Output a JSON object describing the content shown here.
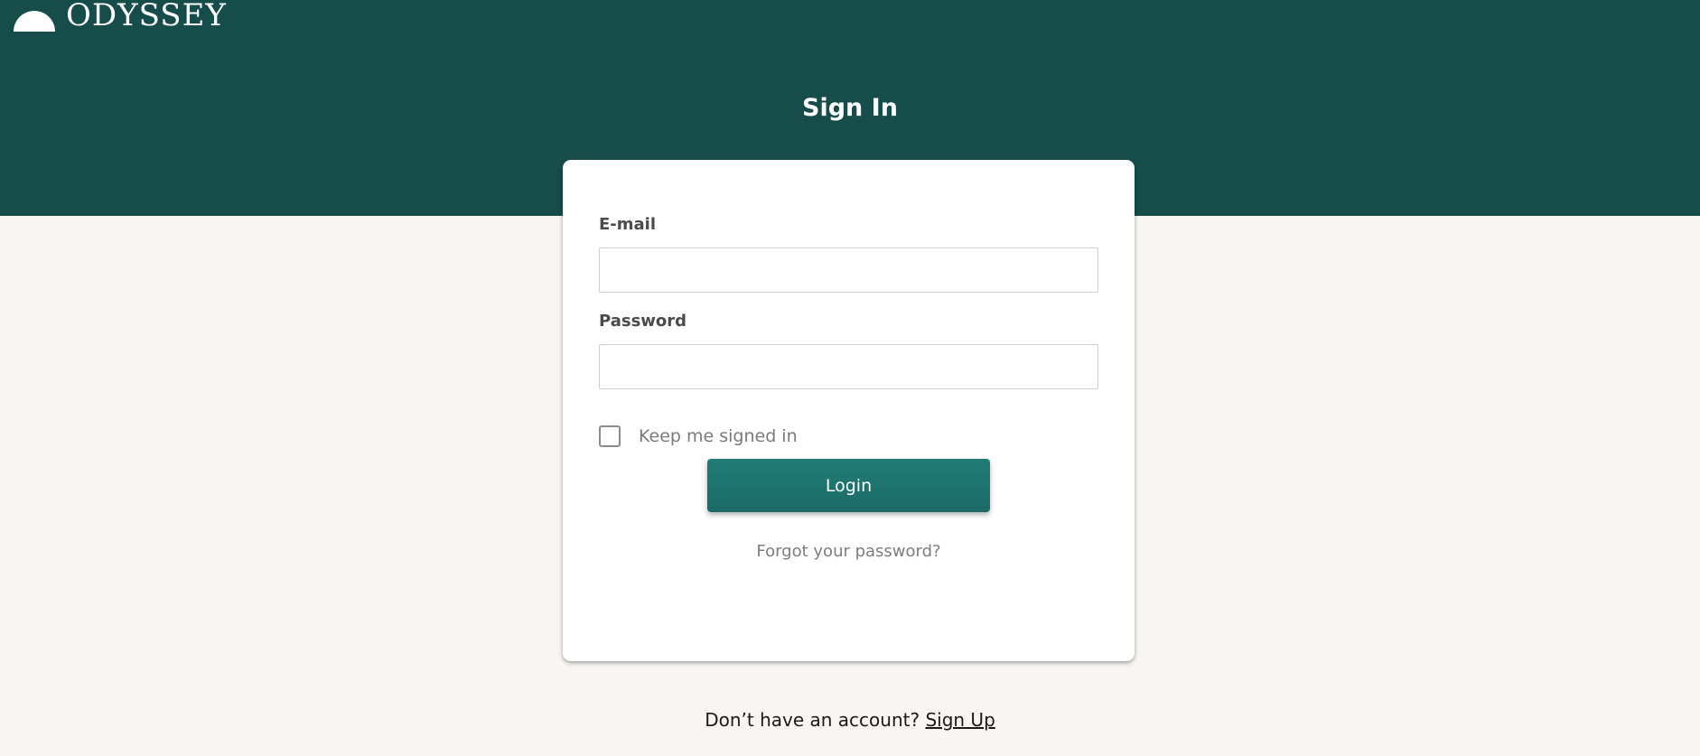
{
  "brand": {
    "name": "ODYSSEY",
    "logo_icon": "half-sun-icon"
  },
  "page": {
    "title": "Sign In"
  },
  "form": {
    "email_label": "E-mail",
    "email_value": "",
    "email_placeholder": "",
    "password_label": "Password",
    "password_value": "",
    "password_placeholder": "",
    "keep_signed_in_label": "Keep me signed in",
    "keep_signed_in_checked": false,
    "login_label": "Login",
    "forgot_label": "Forgot your password?"
  },
  "footer": {
    "prompt": "Don’t have an account?",
    "signup_label": "Sign Up"
  },
  "colors": {
    "banner": "#164d4b",
    "button": "#1f7671",
    "background": "#f8f5f2"
  }
}
